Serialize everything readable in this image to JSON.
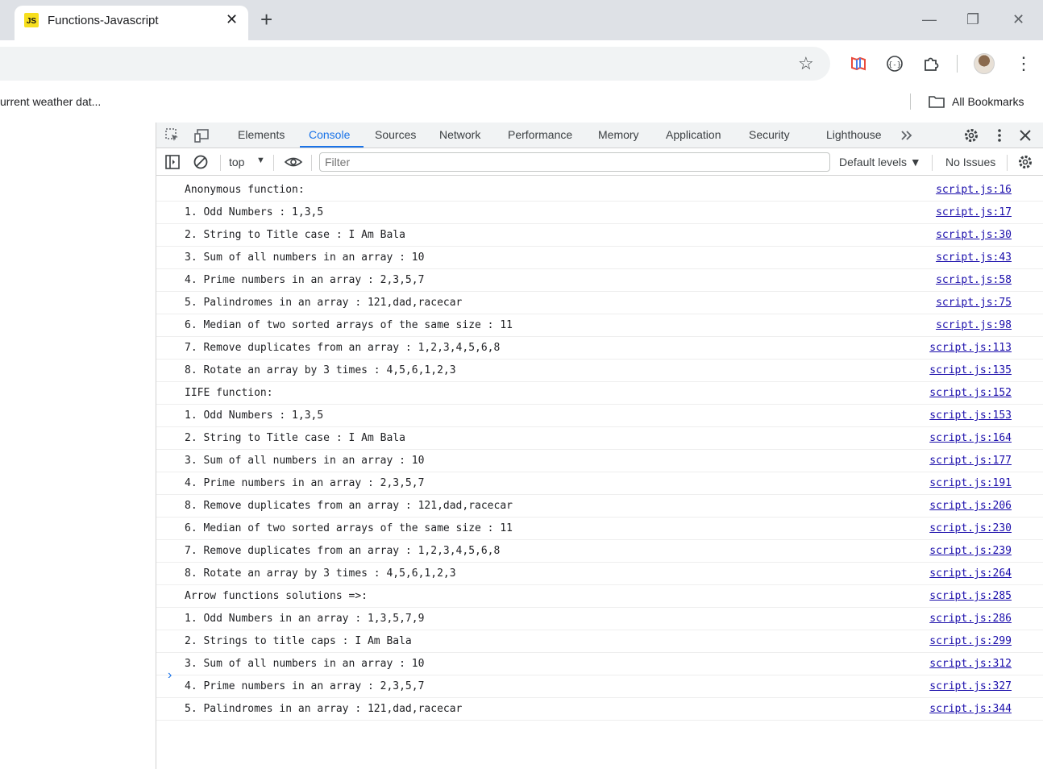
{
  "browser": {
    "tab": {
      "favicon": "JS",
      "title": "Functions-Javascript"
    },
    "bookmarks": {
      "truncated_item": "urrent weather dat...",
      "all_bookmarks": "All Bookmarks"
    }
  },
  "devtools": {
    "tabs": [
      "Elements",
      "Console",
      "Sources",
      "Network",
      "Performance",
      "Memory",
      "Application",
      "Security",
      "Lighthouse"
    ],
    "active_tab": "Console",
    "context": "top",
    "filter_placeholder": "Filter",
    "levels": "Default levels",
    "issues": "No Issues"
  },
  "console": {
    "messages": [
      {
        "text": "Anonymous function:",
        "source": "script.js:16"
      },
      {
        "text": "1. Odd Numbers : 1,3,5",
        "source": "script.js:17"
      },
      {
        "text": "2. String to Title case : I Am Bala",
        "source": "script.js:30"
      },
      {
        "text": "3. Sum of all numbers in an array : 10",
        "source": "script.js:43"
      },
      {
        "text": "4. Prime numbers in an array : 2,3,5,7",
        "source": "script.js:58"
      },
      {
        "text": "5. Palindromes in an array : 121,dad,racecar",
        "source": "script.js:75"
      },
      {
        "text": "6. Median of two sorted arrays of the same size : 11",
        "source": "script.js:98"
      },
      {
        "text": "7. Remove duplicates from an array : 1,2,3,4,5,6,8",
        "source": "script.js:113"
      },
      {
        "text": "8. Rotate an array by 3 times : 4,5,6,1,2,3",
        "source": "script.js:135"
      },
      {
        "text": "IIFE function:",
        "source": "script.js:152"
      },
      {
        "text": "1. Odd Numbers : 1,3,5",
        "source": "script.js:153"
      },
      {
        "text": "2. String to Title case : I Am Bala",
        "source": "script.js:164"
      },
      {
        "text": "3. Sum of all numbers in an array : 10",
        "source": "script.js:177"
      },
      {
        "text": "4. Prime numbers in an array : 2,3,5,7",
        "source": "script.js:191"
      },
      {
        "text": "8. Remove duplicates from an array : 121,dad,racecar",
        "source": "script.js:206"
      },
      {
        "text": "6. Median of two sorted arrays of the same size : 11",
        "source": "script.js:230"
      },
      {
        "text": "7. Remove duplicates from an array : 1,2,3,4,5,6,8",
        "source": "script.js:239"
      },
      {
        "text": "8. Rotate an array by 3 times : 4,5,6,1,2,3",
        "source": "script.js:264"
      },
      {
        "text": "Arrow functions solutions =>:",
        "source": "script.js:285"
      },
      {
        "text": "1. Odd Numbers in an array : 1,3,5,7,9",
        "source": "script.js:286"
      },
      {
        "text": "2. Strings to title caps : I Am Bala",
        "source": "script.js:299"
      },
      {
        "text": "3. Sum of all numbers in an array : 10",
        "source": "script.js:312"
      },
      {
        "text": "4. Prime numbers in an array : 2,3,5,7",
        "source": "script.js:327"
      },
      {
        "text": "5. Palindromes in an array : 121,dad,racecar",
        "source": "script.js:344"
      }
    ]
  },
  "icons": {
    "tab_close": "close-icon",
    "new_tab": "plus-icon",
    "bookmark": "star-icon",
    "prompt": "chevron-right-icon",
    "more_tabs": "double-chevron-icon"
  },
  "colors": {
    "accent": "#1a73e8",
    "link": "#1a0dab",
    "js_yellow": "#f7df1e",
    "tabstrip": "#dee1e6"
  }
}
